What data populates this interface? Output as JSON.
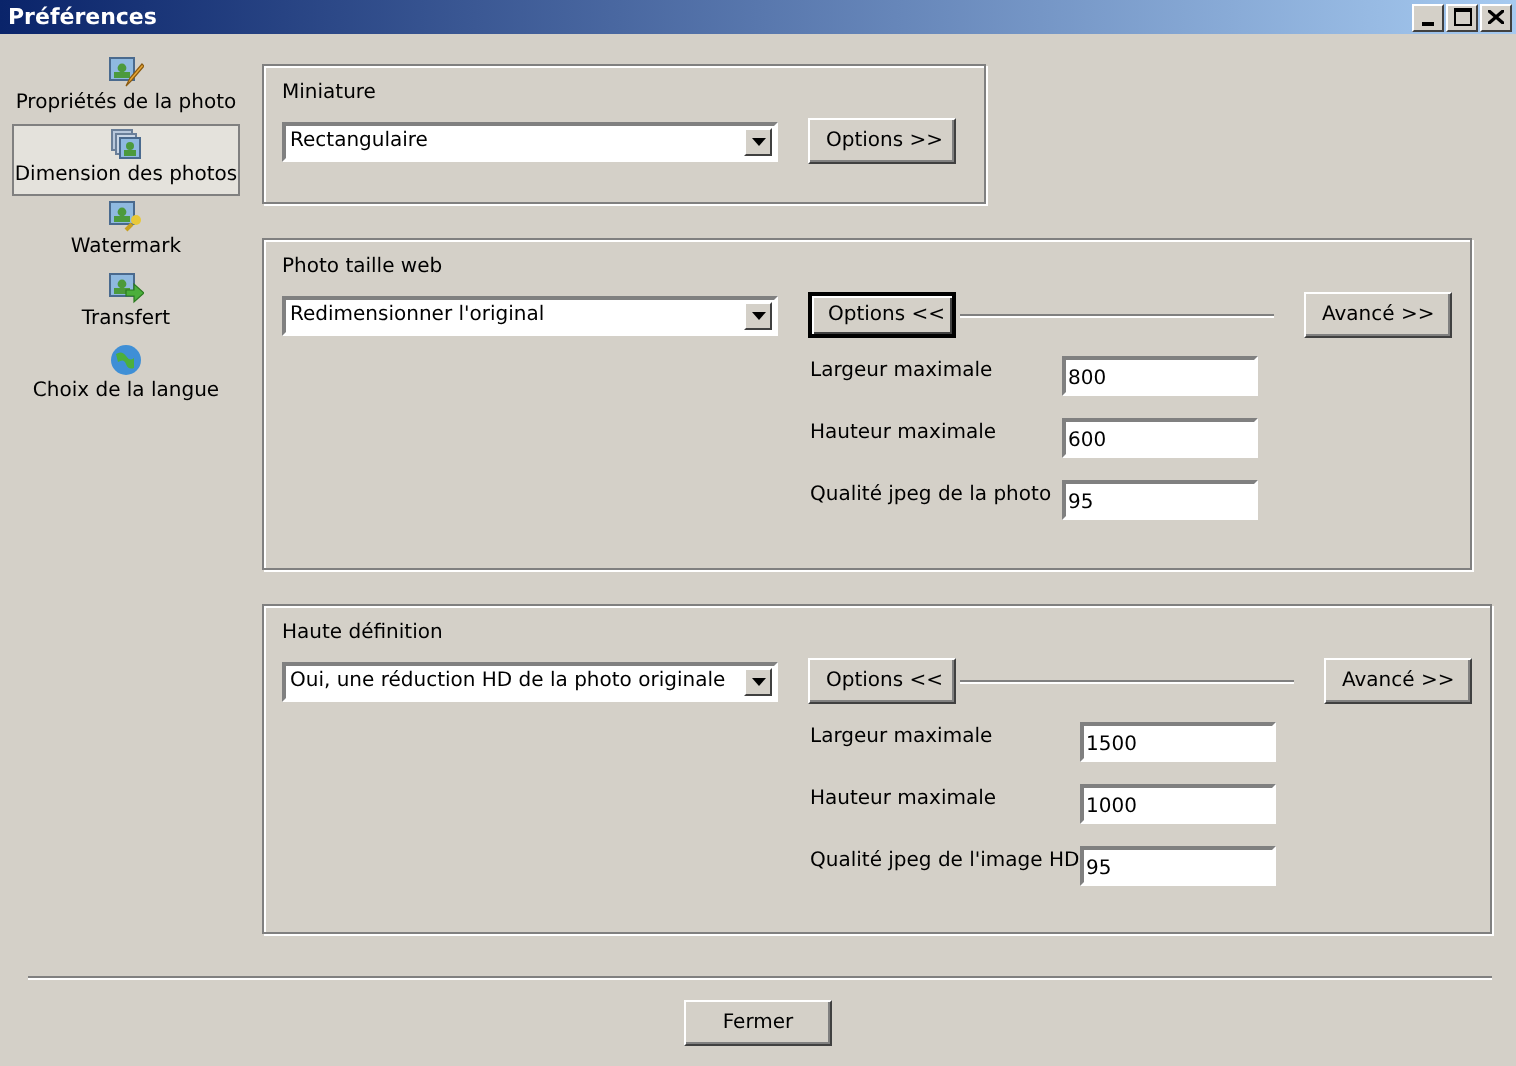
{
  "window": {
    "title": "Préférences"
  },
  "sidebar": {
    "items": [
      {
        "label": "Propriétés de la photo",
        "selected": false
      },
      {
        "label": "Dimension des photos",
        "selected": true
      },
      {
        "label": "Watermark",
        "selected": false
      },
      {
        "label": "Transfert",
        "selected": false
      },
      {
        "label": "Choix de la langue",
        "selected": false
      }
    ]
  },
  "sections": [
    {
      "title": "Miniature",
      "select": "Rectangulaire",
      "options_button": {
        "label": "Options >>",
        "focused": false
      }
    },
    {
      "title": "Photo taille web",
      "select": "Redimensionner l'original",
      "options_button": {
        "label": "Options <<",
        "focused": true
      },
      "advanced_button": "Avancé >>",
      "fields": [
        {
          "label": "Largeur maximale",
          "value": "800"
        },
        {
          "label": "Hauteur maximale",
          "value": "600"
        },
        {
          "label": "Qualité jpeg de la photo",
          "value": "95"
        }
      ]
    },
    {
      "title": "Haute définition",
      "select": "Oui, une réduction HD de la photo originale",
      "options_button": {
        "label": "Options <<",
        "focused": false
      },
      "advanced_button": "Avancé >>",
      "fields": [
        {
          "label": "Largeur maximale",
          "value": "1500"
        },
        {
          "label": "Hauteur maximale",
          "value": "1000"
        },
        {
          "label": "Qualité jpeg de l'image HD",
          "value": "95"
        }
      ]
    }
  ],
  "close_button": "Fermer"
}
